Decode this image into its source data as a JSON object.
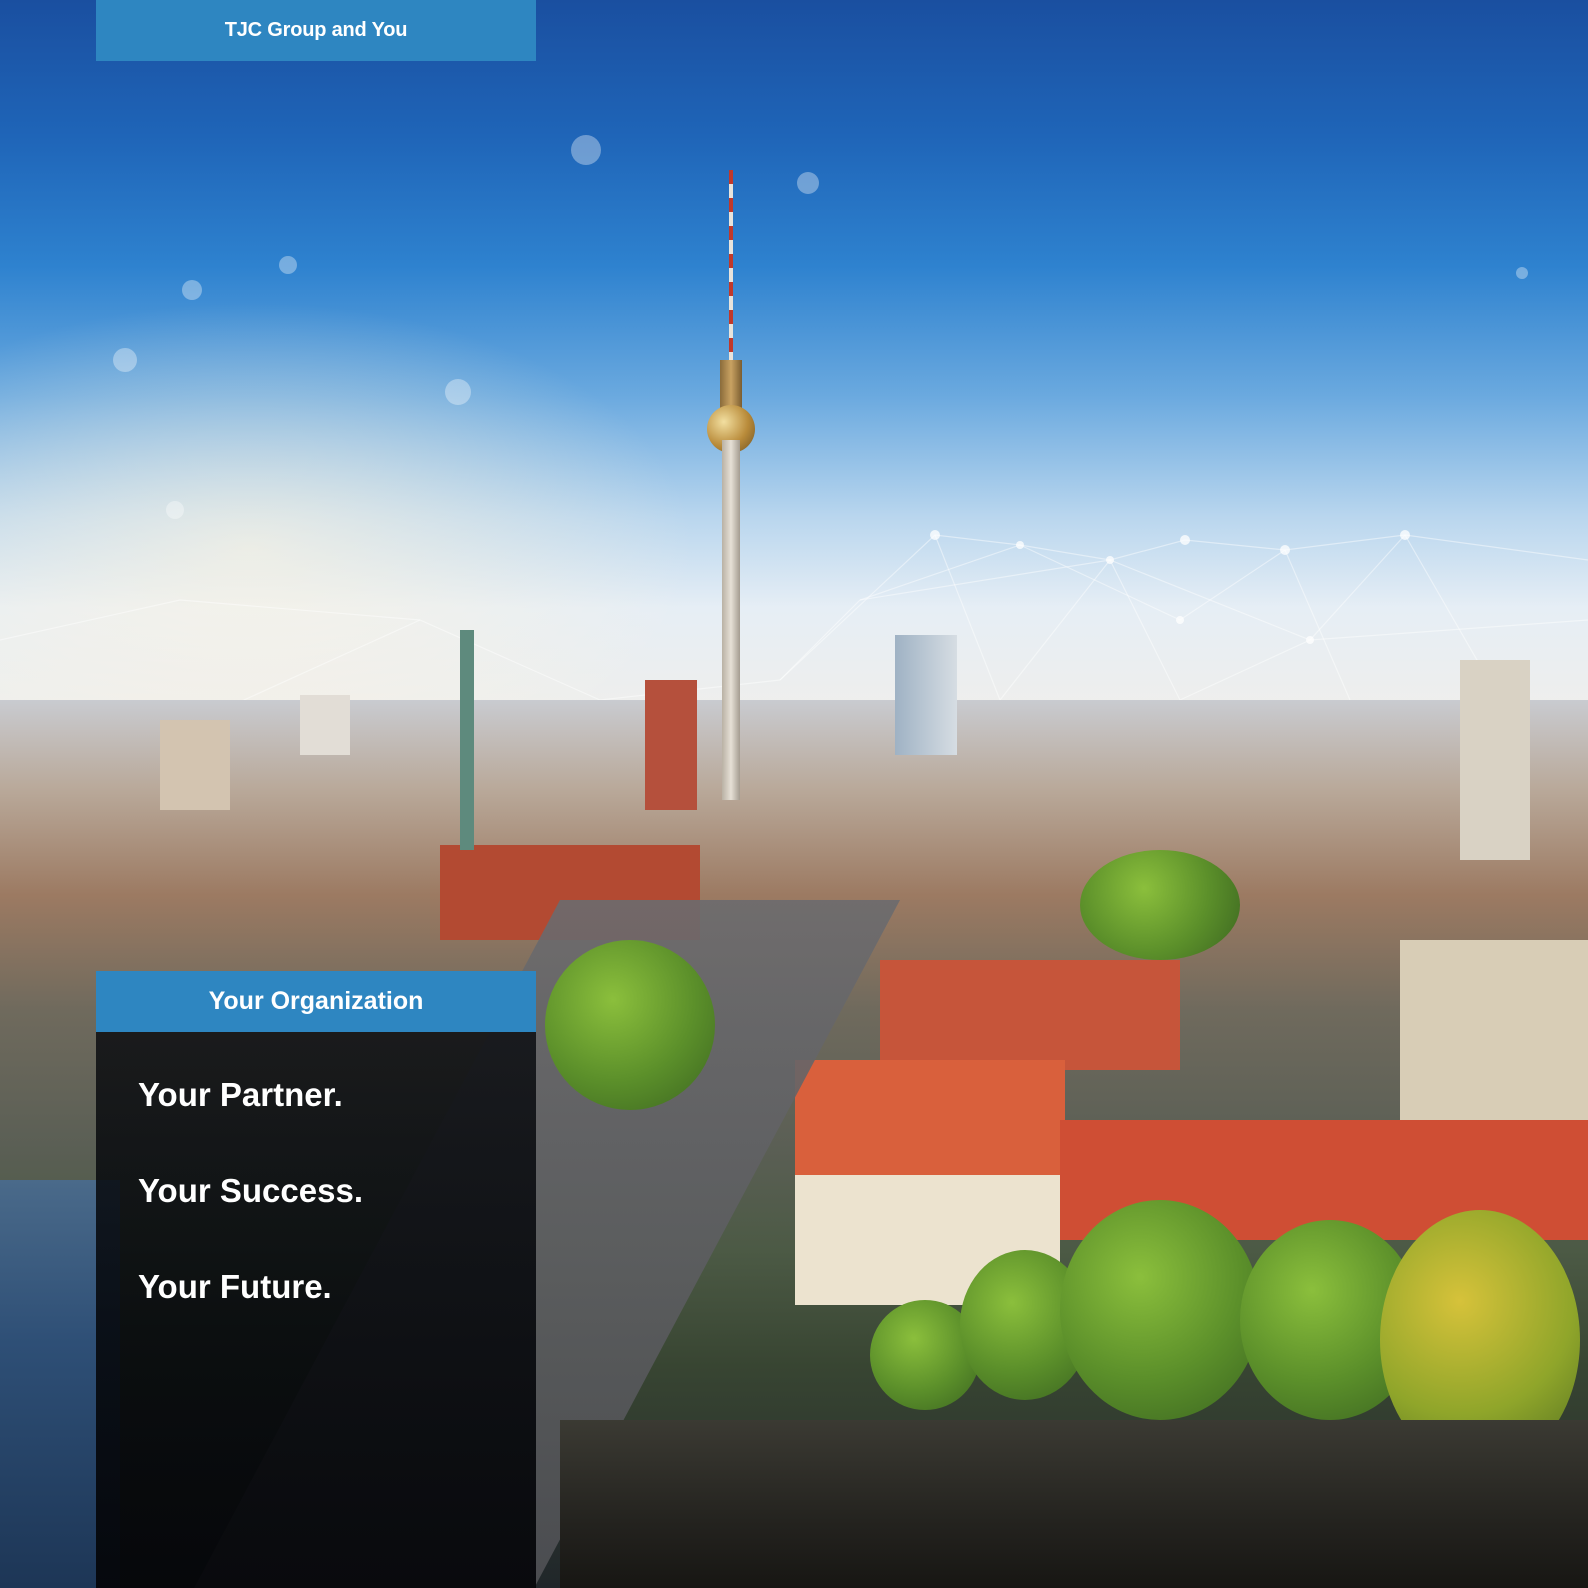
{
  "header": {
    "tab_label": "TJC Group and You"
  },
  "organization_panel": {
    "title": "Your Organization",
    "taglines": [
      "Your Partner.",
      "Your Success.",
      "Your Future."
    ]
  },
  "colors": {
    "accent_blue": "#2e86c1",
    "panel_dark": "#080a0e",
    "text": "#ffffff"
  },
  "background": {
    "description_icon": "city-skyline-photo"
  }
}
